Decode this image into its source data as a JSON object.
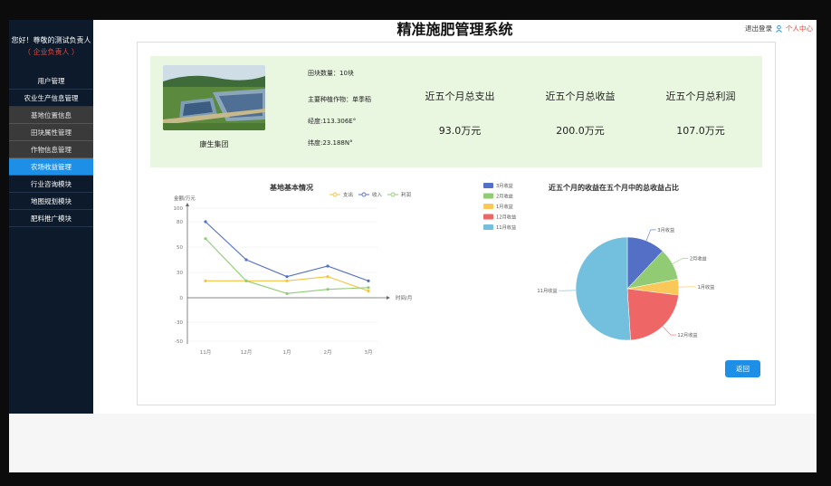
{
  "sidebar": {
    "greeting": "您好！尊敬的测试负责人",
    "role": "（ 企业负责人 ）",
    "items": [
      {
        "label": "用户管理",
        "kind": "top"
      },
      {
        "label": "农业生产信息管理",
        "kind": "top"
      },
      {
        "label": "基地位置信息",
        "kind": "sub"
      },
      {
        "label": "田块属性管理",
        "kind": "sub"
      },
      {
        "label": "作物信息管理",
        "kind": "sub"
      },
      {
        "label": "农场收益管理",
        "kind": "active"
      },
      {
        "label": "行业咨询模块",
        "kind": "top"
      },
      {
        "label": "地图规划模块",
        "kind": "top"
      },
      {
        "label": "肥料推广模块",
        "kind": "top"
      }
    ]
  },
  "header": {
    "title": "精准施肥管理系统",
    "logout": "退出登录",
    "profile": "个人中心"
  },
  "info": {
    "company": "康生集团",
    "facts": [
      "田块数量：10块",
      "主要种植作物：单季稻",
      "经度:113.306E°",
      "纬度:23.188N°"
    ],
    "stats": [
      {
        "label": "近五个月总支出",
        "value": "93.0万元"
      },
      {
        "label": "近五个月总收益",
        "value": "200.0万元"
      },
      {
        "label": "近五个月总利润",
        "value": "107.0万元"
      }
    ]
  },
  "return_button": "返回",
  "chart_data": [
    {
      "type": "line",
      "title": "基地基本情况",
      "ylabel": "金额/万元",
      "xlabel": "时间/月",
      "categories": [
        "11月",
        "12月",
        "1月",
        "2月",
        "3月"
      ],
      "yticks": [
        100,
        80,
        50,
        30,
        0,
        -30,
        -50
      ],
      "ylim": [
        -50,
        100
      ],
      "legend_position": "top-right",
      "series": [
        {
          "name": "支出",
          "values": [
            20,
            20,
            20,
            25,
            8
          ],
          "color": "#f5c242"
        },
        {
          "name": "收入",
          "values": [
            80,
            40,
            25,
            35,
            20
          ],
          "color": "#5470c6"
        },
        {
          "name": "利润",
          "values": [
            60,
            20,
            5,
            10,
            12
          ],
          "color": "#91cc75"
        }
      ]
    },
    {
      "type": "pie",
      "title": "近五个月的收益在五个月中的总收益占比",
      "legend_position": "top-left",
      "slices": [
        {
          "name": "3月收益",
          "value": 24,
          "color": "#5470c6"
        },
        {
          "name": "2月收益",
          "value": 20,
          "color": "#91cc75"
        },
        {
          "name": "1月收益",
          "value": 10,
          "color": "#fac858"
        },
        {
          "name": "12月收益",
          "value": 44,
          "color": "#ee6666"
        },
        {
          "name": "11月收益",
          "value": 102,
          "color": "#73c0de"
        }
      ]
    }
  ]
}
